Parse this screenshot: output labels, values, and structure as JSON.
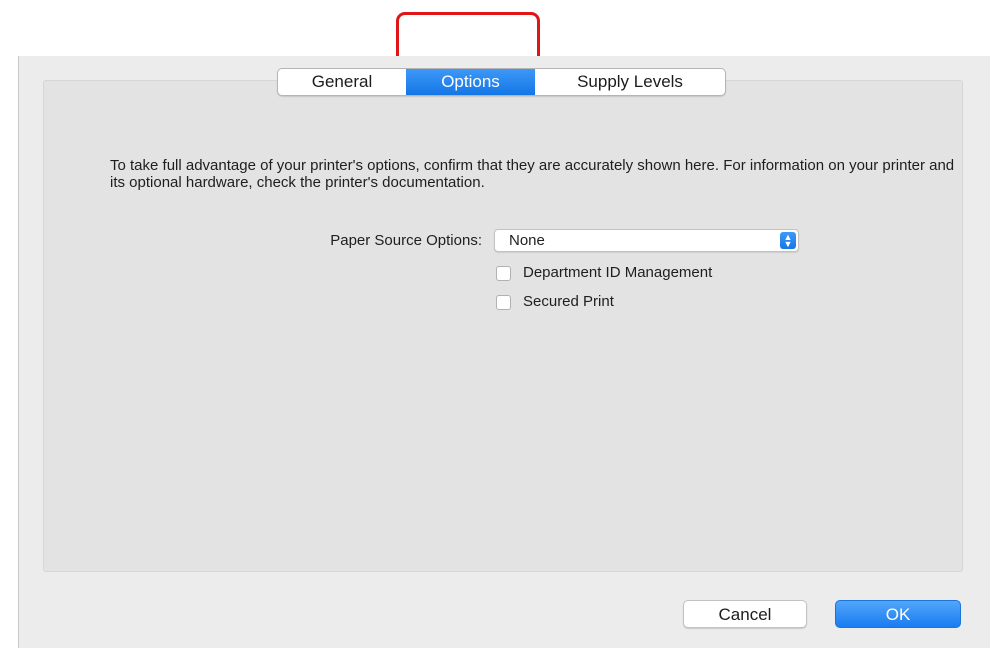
{
  "tabs": {
    "general": "General",
    "options": "Options",
    "supply_levels": "Supply Levels",
    "selected": "Options"
  },
  "description": "To take full advantage of your printer's options, confirm that they are accurately shown here. For information on your printer and its optional hardware, check the printer's documentation.",
  "paper_source": {
    "label": "Paper Source Options:",
    "value": "None"
  },
  "checkboxes": [
    {
      "label": "Department ID Management",
      "checked": false
    },
    {
      "label": "Secured Print",
      "checked": false
    }
  ],
  "buttons": {
    "cancel": "Cancel",
    "ok": "OK"
  },
  "colors": {
    "accent": "#1a7cf0",
    "highlight": "#e01616",
    "panel": "#e3e3e3"
  }
}
